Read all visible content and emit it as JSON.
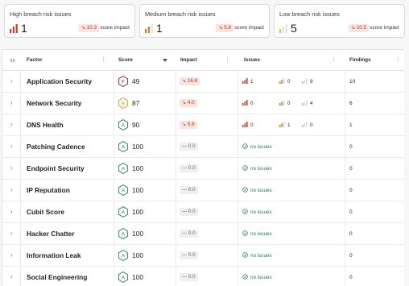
{
  "summary": [
    {
      "title": "High breach risk issues",
      "count": "1",
      "impact": "↘ 10.3",
      "impact_label": "score impact",
      "level": "high"
    },
    {
      "title": "Medium breach risk issues",
      "count": "1",
      "impact": "↘ 5.8",
      "impact_label": "score impact",
      "level": "medium"
    },
    {
      "title": "Low breach risk issues",
      "count": "5",
      "impact": "↘ 10.5",
      "impact_label": "score impact",
      "level": "low"
    }
  ],
  "table": {
    "headers": {
      "factor": "Factor",
      "score": "Score",
      "impact": "Impact",
      "issues": "Issues",
      "findings": "Findings"
    },
    "rows": [
      {
        "factor": "Application Security",
        "grade": "F",
        "grade_color": "#8a2a5a",
        "score": "49",
        "impact": "↘ 16.8",
        "impact_type": "neg",
        "high": "1",
        "medium": "0",
        "low": "9",
        "no_issues": null,
        "findings": "10"
      },
      {
        "factor": "Network Security",
        "grade": "B",
        "grade_color": "#e0a020",
        "score": "87",
        "impact": "↘ 4.0",
        "impact_type": "neg",
        "high": "0",
        "medium": "0",
        "low": "4",
        "no_issues": null,
        "findings": "6"
      },
      {
        "factor": "DNS Health",
        "grade": "A",
        "grade_color": "#2f8a6a",
        "score": "90",
        "impact": "↘ 5.8",
        "impact_type": "neg",
        "high": "0",
        "medium": "1",
        "low": "0",
        "no_issues": null,
        "findings": "1"
      },
      {
        "factor": "Patching Cadence",
        "grade": "A",
        "grade_color": "#2f8a6a",
        "score": "100",
        "impact": "— 0.0",
        "impact_type": "zero",
        "no_issues": "no issues",
        "findings": "0"
      },
      {
        "factor": "Endpoint Security",
        "grade": "A",
        "grade_color": "#2f8a6a",
        "score": "100",
        "impact": "— 0.0",
        "impact_type": "zero",
        "no_issues": "no issues",
        "findings": "0"
      },
      {
        "factor": "IP Reputation",
        "grade": "A",
        "grade_color": "#2f8a6a",
        "score": "100",
        "impact": "— 0.0",
        "impact_type": "zero",
        "no_issues": "no issues",
        "findings": "0"
      },
      {
        "factor": "Cubit Score",
        "grade": "A",
        "grade_color": "#2f8a6a",
        "score": "100",
        "impact": "— 0.0",
        "impact_type": "zero",
        "no_issues": "no issues",
        "findings": "0"
      },
      {
        "factor": "Hacker Chatter",
        "grade": "A",
        "grade_color": "#2f8a6a",
        "score": "100",
        "impact": "— 0.0",
        "impact_type": "zero",
        "no_issues": "no issues",
        "findings": "0"
      },
      {
        "factor": "Information Leak",
        "grade": "A",
        "grade_color": "#2f8a6a",
        "score": "100",
        "impact": "— 0.0",
        "impact_type": "zero",
        "no_issues": "no issues",
        "findings": "0"
      },
      {
        "factor": "Social Engineering",
        "grade": "A",
        "grade_color": "#2f8a6a",
        "score": "100",
        "impact": "— 0.0",
        "impact_type": "zero",
        "no_issues": "no issues",
        "findings": "0"
      }
    ]
  },
  "colors": {
    "high": "#d2402e",
    "medium": "#e07a2a",
    "low": "#e6b94a",
    "good": "#1f7a5e"
  }
}
